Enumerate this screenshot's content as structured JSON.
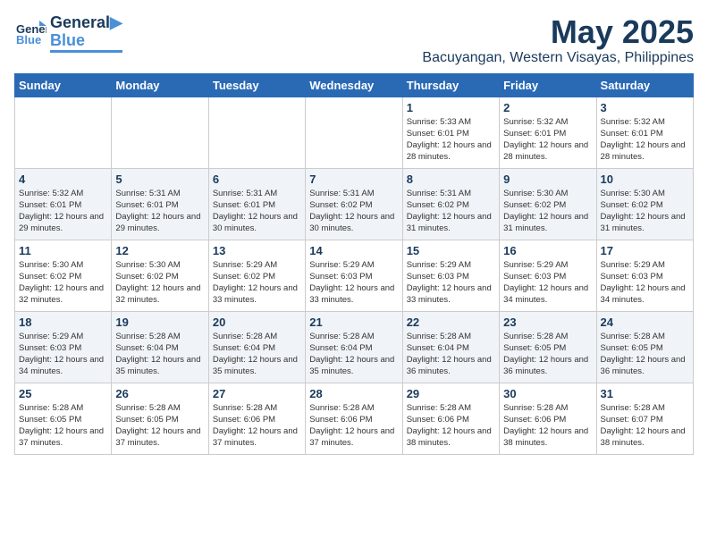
{
  "header": {
    "logo_line1": "General",
    "logo_line2": "Blue",
    "title": "May 2025",
    "subtitle": "Bacuyangan, Western Visayas, Philippines"
  },
  "weekdays": [
    "Sunday",
    "Monday",
    "Tuesday",
    "Wednesday",
    "Thursday",
    "Friday",
    "Saturday"
  ],
  "weeks": [
    [
      {
        "day": "",
        "sunrise": "",
        "sunset": "",
        "daylight": ""
      },
      {
        "day": "",
        "sunrise": "",
        "sunset": "",
        "daylight": ""
      },
      {
        "day": "",
        "sunrise": "",
        "sunset": "",
        "daylight": ""
      },
      {
        "day": "",
        "sunrise": "",
        "sunset": "",
        "daylight": ""
      },
      {
        "day": "1",
        "sunrise": "5:33 AM",
        "sunset": "6:01 PM",
        "daylight": "12 hours and 28 minutes."
      },
      {
        "day": "2",
        "sunrise": "5:32 AM",
        "sunset": "6:01 PM",
        "daylight": "12 hours and 28 minutes."
      },
      {
        "day": "3",
        "sunrise": "5:32 AM",
        "sunset": "6:01 PM",
        "daylight": "12 hours and 28 minutes."
      }
    ],
    [
      {
        "day": "4",
        "sunrise": "5:32 AM",
        "sunset": "6:01 PM",
        "daylight": "12 hours and 29 minutes."
      },
      {
        "day": "5",
        "sunrise": "5:31 AM",
        "sunset": "6:01 PM",
        "daylight": "12 hours and 29 minutes."
      },
      {
        "day": "6",
        "sunrise": "5:31 AM",
        "sunset": "6:01 PM",
        "daylight": "12 hours and 30 minutes."
      },
      {
        "day": "7",
        "sunrise": "5:31 AM",
        "sunset": "6:02 PM",
        "daylight": "12 hours and 30 minutes."
      },
      {
        "day": "8",
        "sunrise": "5:31 AM",
        "sunset": "6:02 PM",
        "daylight": "12 hours and 31 minutes."
      },
      {
        "day": "9",
        "sunrise": "5:30 AM",
        "sunset": "6:02 PM",
        "daylight": "12 hours and 31 minutes."
      },
      {
        "day": "10",
        "sunrise": "5:30 AM",
        "sunset": "6:02 PM",
        "daylight": "12 hours and 31 minutes."
      }
    ],
    [
      {
        "day": "11",
        "sunrise": "5:30 AM",
        "sunset": "6:02 PM",
        "daylight": "12 hours and 32 minutes."
      },
      {
        "day": "12",
        "sunrise": "5:30 AM",
        "sunset": "6:02 PM",
        "daylight": "12 hours and 32 minutes."
      },
      {
        "day": "13",
        "sunrise": "5:29 AM",
        "sunset": "6:02 PM",
        "daylight": "12 hours and 33 minutes."
      },
      {
        "day": "14",
        "sunrise": "5:29 AM",
        "sunset": "6:03 PM",
        "daylight": "12 hours and 33 minutes."
      },
      {
        "day": "15",
        "sunrise": "5:29 AM",
        "sunset": "6:03 PM",
        "daylight": "12 hours and 33 minutes."
      },
      {
        "day": "16",
        "sunrise": "5:29 AM",
        "sunset": "6:03 PM",
        "daylight": "12 hours and 34 minutes."
      },
      {
        "day": "17",
        "sunrise": "5:29 AM",
        "sunset": "6:03 PM",
        "daylight": "12 hours and 34 minutes."
      }
    ],
    [
      {
        "day": "18",
        "sunrise": "5:29 AM",
        "sunset": "6:03 PM",
        "daylight": "12 hours and 34 minutes."
      },
      {
        "day": "19",
        "sunrise": "5:28 AM",
        "sunset": "6:04 PM",
        "daylight": "12 hours and 35 minutes."
      },
      {
        "day": "20",
        "sunrise": "5:28 AM",
        "sunset": "6:04 PM",
        "daylight": "12 hours and 35 minutes."
      },
      {
        "day": "21",
        "sunrise": "5:28 AM",
        "sunset": "6:04 PM",
        "daylight": "12 hours and 35 minutes."
      },
      {
        "day": "22",
        "sunrise": "5:28 AM",
        "sunset": "6:04 PM",
        "daylight": "12 hours and 36 minutes."
      },
      {
        "day": "23",
        "sunrise": "5:28 AM",
        "sunset": "6:05 PM",
        "daylight": "12 hours and 36 minutes."
      },
      {
        "day": "24",
        "sunrise": "5:28 AM",
        "sunset": "6:05 PM",
        "daylight": "12 hours and 36 minutes."
      }
    ],
    [
      {
        "day": "25",
        "sunrise": "5:28 AM",
        "sunset": "6:05 PM",
        "daylight": "12 hours and 37 minutes."
      },
      {
        "day": "26",
        "sunrise": "5:28 AM",
        "sunset": "6:05 PM",
        "daylight": "12 hours and 37 minutes."
      },
      {
        "day": "27",
        "sunrise": "5:28 AM",
        "sunset": "6:06 PM",
        "daylight": "12 hours and 37 minutes."
      },
      {
        "day": "28",
        "sunrise": "5:28 AM",
        "sunset": "6:06 PM",
        "daylight": "12 hours and 37 minutes."
      },
      {
        "day": "29",
        "sunrise": "5:28 AM",
        "sunset": "6:06 PM",
        "daylight": "12 hours and 38 minutes."
      },
      {
        "day": "30",
        "sunrise": "5:28 AM",
        "sunset": "6:06 PM",
        "daylight": "12 hours and 38 minutes."
      },
      {
        "day": "31",
        "sunrise": "5:28 AM",
        "sunset": "6:07 PM",
        "daylight": "12 hours and 38 minutes."
      }
    ]
  ]
}
